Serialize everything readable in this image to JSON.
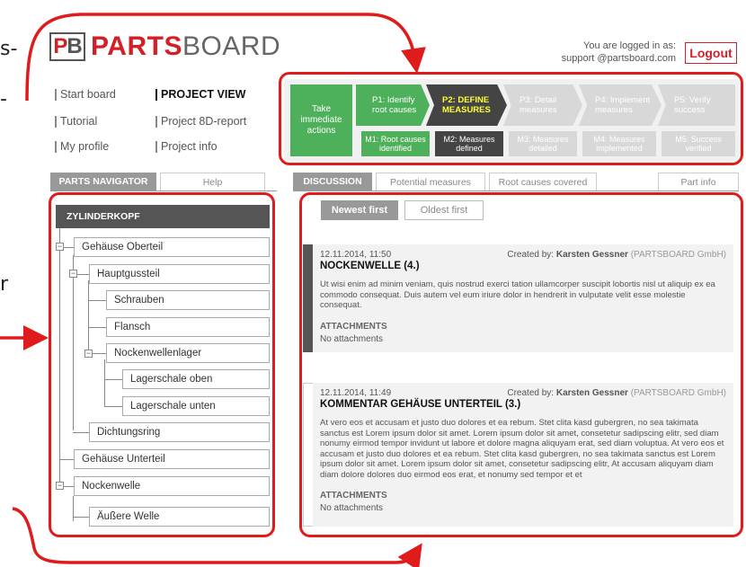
{
  "fragments": {
    "line1": "s-",
    "line2": "-",
    "line3": "r"
  },
  "logo": {
    "pb_p": "P",
    "pb_b": "B",
    "word_red": "PARTS",
    "word_grey": "BOARD"
  },
  "header": {
    "login_line1": "You are logged in as:",
    "login_line2": "support @partsboard.com",
    "logout": "Logout"
  },
  "nav": {
    "col1": [
      "Start board",
      "Tutorial",
      "My profile"
    ],
    "col2": [
      "PROJECT VIEW",
      "Project 8D-report",
      "Project info"
    ]
  },
  "process": {
    "take": "Take immediate actions",
    "steps": [
      {
        "label": "P1: Identify root causes",
        "state": "done",
        "color": "#4eb05a"
      },
      {
        "label": "P2: DEFINE MEASURES",
        "state": "current",
        "color": "#444444",
        "text_color": "#ffff33"
      },
      {
        "label": "P3: Detail measures",
        "state": "todo",
        "color": "#d8d8d8"
      },
      {
        "label": "P4: Implement measures",
        "state": "todo",
        "color": "#d8d8d8"
      },
      {
        "label": "P5: Verify success",
        "state": "todo",
        "color": "#d8d8d8"
      }
    ],
    "milestones": [
      {
        "label": "M1: Root causes identified",
        "color": "#4eb05a"
      },
      {
        "label": "M2: Measures defined",
        "color": "#444444"
      },
      {
        "label": "M3: Measures detailed",
        "color": "#d8d8d8"
      },
      {
        "label": "M4: Measures implemented",
        "color": "#d8d8d8"
      },
      {
        "label": "M5: Success verified",
        "color": "#d8d8d8"
      }
    ]
  },
  "navigator": {
    "tab_active": "PARTS NAVIGATOR",
    "tab_help": "Help",
    "root": "ZYLINDERKOPF",
    "nodes": [
      "Gehäuse Oberteil",
      "Hauptgussteil",
      "Schrauben",
      "Flansch",
      "Nockenwellenlager",
      "Lagerschale oben",
      "Lagerschale unten",
      "Dichtungsring",
      "Gehäuse Unterteil",
      "Nockenwelle",
      "Äußere Welle"
    ]
  },
  "discussion": {
    "tabs": [
      "DISCUSSION",
      "Potential measures",
      "Root causes covered",
      "Part info"
    ],
    "sort": [
      "Newest first",
      "Oldest first"
    ],
    "posts": [
      {
        "date": "12.11.2014, 11:50",
        "created_by": "Created by:",
        "author": "Karsten Gessner",
        "org": "(PARTSBOARD GmbH)",
        "title": "NOCKENWELLE (4.)",
        "body": "Ut wisi enim ad minim veniam, quis nostrud exerci tation ullamcorper suscipit lobortis nisl ut aliquip ex ea commodo consequat. Duis autem vel eum iriure dolor in hendrerit in vulputate velit esse molestie consequat.",
        "att_label": "ATTACHMENTS",
        "att_val": "No attachments"
      },
      {
        "date": "12.11.2014, 11:49",
        "created_by": "Created by:",
        "author": "Karsten Gessner",
        "org": "(PARTSBOARD GmbH)",
        "title": "KOMMENTAR GEHÄUSE UNTERTEIL (3.)",
        "body": "At vero eos et accusam et justo duo dolores et ea rebum. Stet clita kasd gubergren, no sea takimata sanctus est Lorem ipsum dolor sit amet. Lorem ipsum dolor sit amet, consetetur sadipscing elitr, sed diam nonumy eirmod tempor invidunt ut labore et dolore magna aliquyam erat, sed diam voluptua. At vero eos et accusam et justo duo dolores et ea rebum. Stet clita kasd gubergren, no sea takimata sanctus est Lorem ipsum dolor sit amet. Lorem ipsum dolor sit amet, consetetur sadipscing elitr, At accusam aliquyam diam diam dolore dolores duo eirmod eos erat, et nonumy sed tempor et et",
        "att_label": "ATTACHMENTS",
        "att_val": "No attachments"
      }
    ]
  },
  "annotation_color": "#e01b1b"
}
